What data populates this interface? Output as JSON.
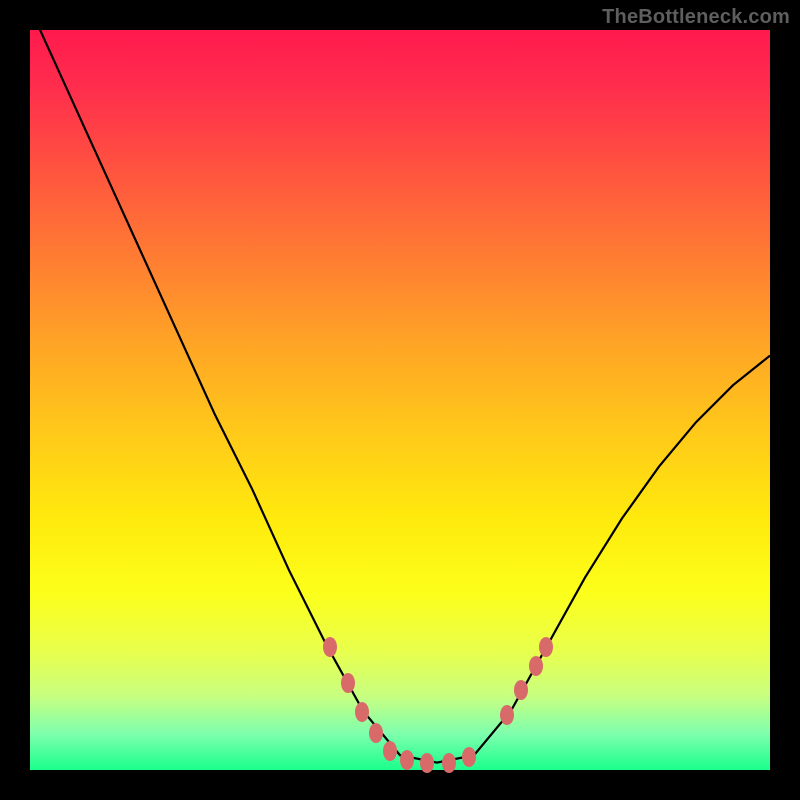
{
  "watermark": "TheBottleneck.com",
  "chart_data": {
    "type": "line",
    "title": "",
    "xlabel": "",
    "ylabel": "",
    "xlim": [
      0,
      1
    ],
    "ylim": [
      0,
      1
    ],
    "series": [
      {
        "name": "curve",
        "x": [
          0.0,
          0.05,
          0.1,
          0.15,
          0.2,
          0.25,
          0.3,
          0.35,
          0.4,
          0.45,
          0.5,
          0.55,
          0.6,
          0.65,
          0.7,
          0.75,
          0.8,
          0.85,
          0.9,
          0.95,
          1.0
        ],
        "values": [
          1.03,
          0.92,
          0.81,
          0.7,
          0.59,
          0.48,
          0.38,
          0.27,
          0.17,
          0.08,
          0.02,
          0.01,
          0.02,
          0.08,
          0.17,
          0.26,
          0.34,
          0.41,
          0.47,
          0.52,
          0.56
        ]
      }
    ],
    "markers": [
      {
        "x": 0.406,
        "y": 0.166
      },
      {
        "x": 0.43,
        "y": 0.117
      },
      {
        "x": 0.449,
        "y": 0.079
      },
      {
        "x": 0.467,
        "y": 0.05
      },
      {
        "x": 0.487,
        "y": 0.026
      },
      {
        "x": 0.51,
        "y": 0.013
      },
      {
        "x": 0.536,
        "y": 0.01
      },
      {
        "x": 0.566,
        "y": 0.01
      },
      {
        "x": 0.593,
        "y": 0.017
      },
      {
        "x": 0.645,
        "y": 0.075
      },
      {
        "x": 0.664,
        "y": 0.108
      },
      {
        "x": 0.684,
        "y": 0.141
      },
      {
        "x": 0.697,
        "y": 0.166
      }
    ]
  }
}
